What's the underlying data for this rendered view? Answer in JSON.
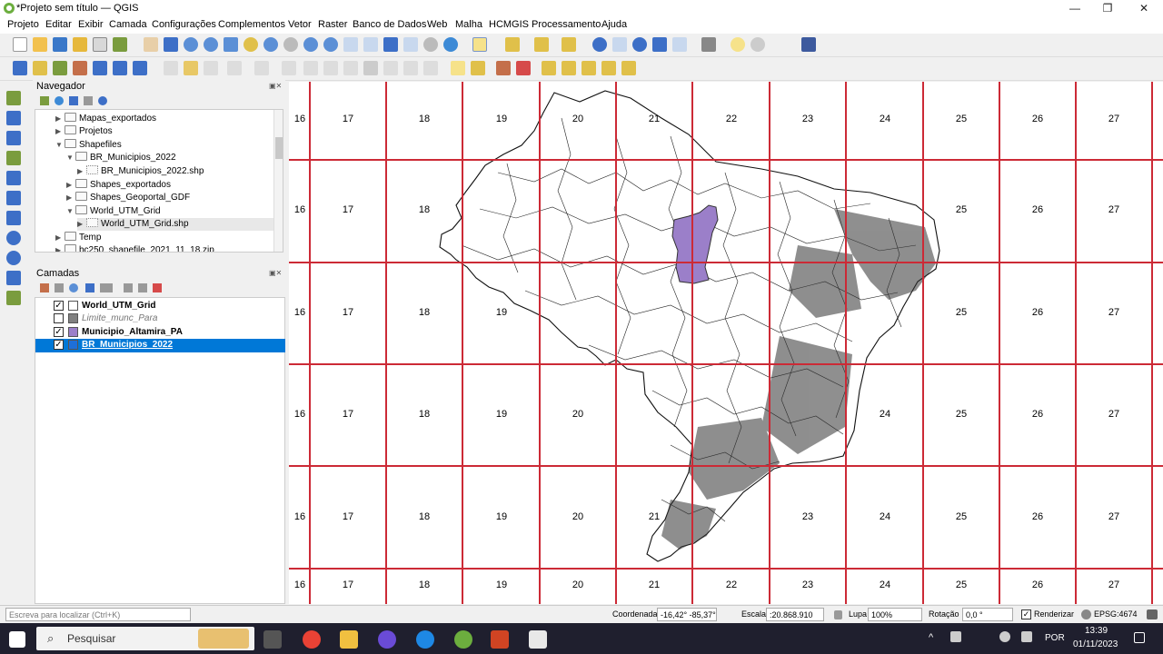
{
  "window": {
    "title": "*Projeto sem título — QGIS",
    "min": "—",
    "max": "❐",
    "close": "✕"
  },
  "menu": [
    "Projeto",
    "Editar",
    "Exibir",
    "Camada",
    "Configurações",
    "Complementos",
    "Vetor",
    "Raster",
    "Banco de Dados",
    "Web",
    "Malha",
    "HCMGIS",
    "Processamento",
    "Ajuda"
  ],
  "navigator": {
    "title": "Navegador",
    "items": [
      {
        "label": "Mapas_exportados",
        "level": 1,
        "expanded": false
      },
      {
        "label": "Projetos",
        "level": 1,
        "expanded": false
      },
      {
        "label": "Shapefiles",
        "level": 1,
        "expanded": true
      },
      {
        "label": "BR_Municipios_2022",
        "level": 2,
        "expanded": true
      },
      {
        "label": "BR_Municipios_2022.shp",
        "level": 3,
        "expanded": false
      },
      {
        "label": "Shapes_exportados",
        "level": 2,
        "expanded": false
      },
      {
        "label": "Shapes_Geoportal_GDF",
        "level": 2,
        "expanded": false
      },
      {
        "label": "World_UTM_Grid",
        "level": 2,
        "expanded": true
      },
      {
        "label": "World_UTM_Grid.shp",
        "level": 3,
        "expanded": false
      },
      {
        "label": "Temp",
        "level": 1,
        "expanded": false
      },
      {
        "label": "bc250_shapefile_2021_11_18.zip",
        "level": 1,
        "expanded": false
      }
    ]
  },
  "layers": {
    "title": "Camadas",
    "items": [
      {
        "label": "World_UTM_Grid",
        "checked": true,
        "color": "#ffffff",
        "style": "bold"
      },
      {
        "label": "Limite_munc_Para",
        "checked": false,
        "color": "#808080",
        "style": "italic"
      },
      {
        "label": "Municipio_Altamira_PA",
        "checked": true,
        "color": "#9b7fc9",
        "style": "bold"
      },
      {
        "label": "BR_Municipios_2022",
        "checked": true,
        "color": "#1e6fd9",
        "style": "selected"
      }
    ]
  },
  "map": {
    "grid_color": "#cc2a36",
    "rows": [
      [
        "16",
        "17",
        "18",
        "19",
        "20",
        "21",
        "22",
        "23",
        "24",
        "25",
        "26",
        "27"
      ],
      [
        "16",
        "17",
        "18",
        "",
        "",
        "",
        "",
        "",
        "",
        "25",
        "26",
        "27"
      ],
      [
        "16",
        "17",
        "18",
        "19",
        "",
        "",
        "",
        "",
        "",
        "25",
        "26",
        "27"
      ],
      [
        "16",
        "17",
        "18",
        "19",
        "20",
        "",
        "",
        "",
        "24",
        "25",
        "26",
        "27"
      ],
      [
        "16",
        "17",
        "18",
        "19",
        "20",
        "21",
        "",
        "23",
        "24",
        "25",
        "26",
        "27"
      ],
      [
        "16",
        "17",
        "18",
        "19",
        "20",
        "21",
        "22",
        "23",
        "24",
        "25",
        "26",
        "27"
      ]
    ]
  },
  "status": {
    "search_placeholder": "Escreva para localizar (Ctrl+K)",
    "coord_label": "Coordenada",
    "coord_value": "-16,42° -85,37°",
    "scale_label": "Escala",
    "scale_value": ":20.868.910",
    "lupa_label": "Lupa",
    "lupa_value": "100%",
    "rot_label": "Rotação",
    "rot_value": "0,0 °",
    "render_label": "Renderizar",
    "epsg": "EPSG:4674"
  },
  "taskbar": {
    "search": "Pesquisar",
    "lang": "POR",
    "time": "13:39",
    "date": "01/11/2023"
  }
}
